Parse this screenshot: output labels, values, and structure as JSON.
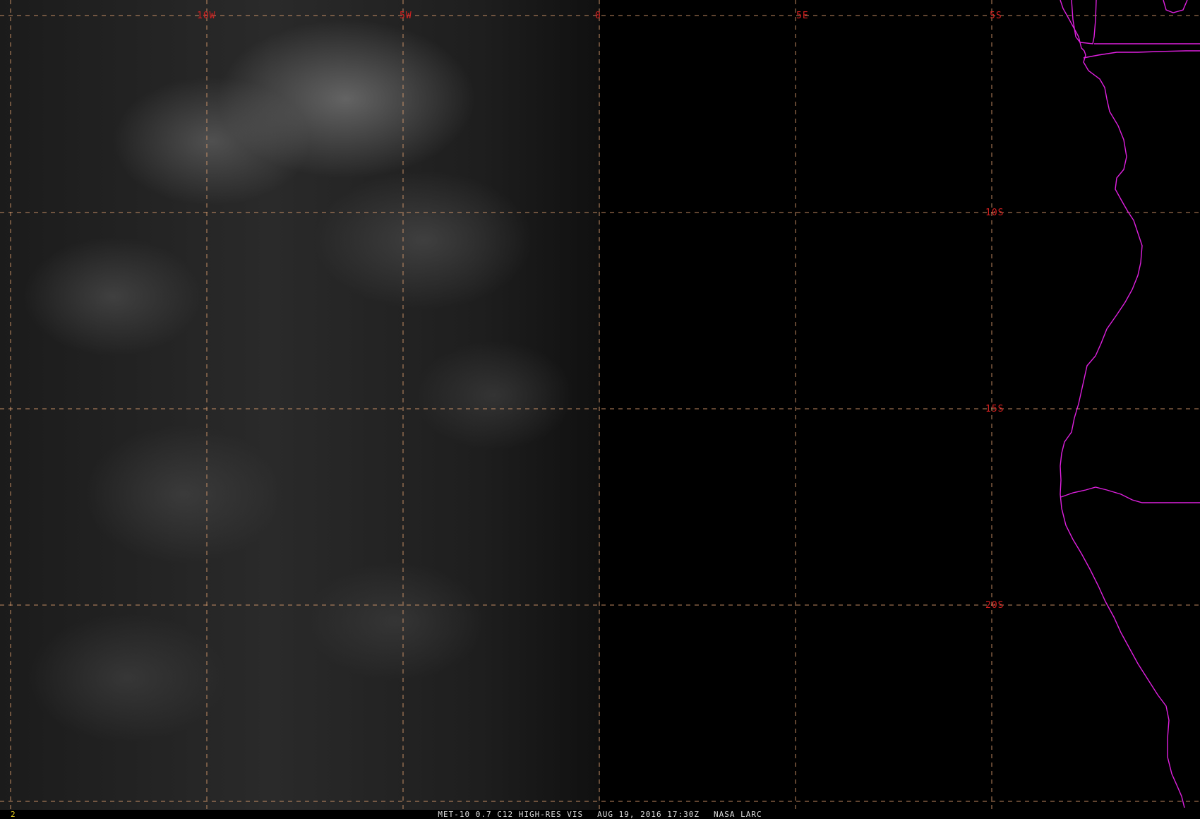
{
  "map": {
    "longitude_labels": [
      "10W",
      "5W",
      "0",
      "5E"
    ],
    "latitude_labels": [
      "5S",
      "10S",
      "15S",
      "20S"
    ],
    "grid_color": "#e0a070",
    "label_color": "#d42020",
    "border_color": "#e020e0"
  },
  "footer": {
    "panel_number": "2",
    "product": "MET-10 0.7 C12 HIGH-RES VIS",
    "datetime": "AUG 19, 2016 17:30Z",
    "source": "NASA LARC",
    "text_color": "#dcdcdc",
    "panel_number_color": "#e8d020"
  }
}
